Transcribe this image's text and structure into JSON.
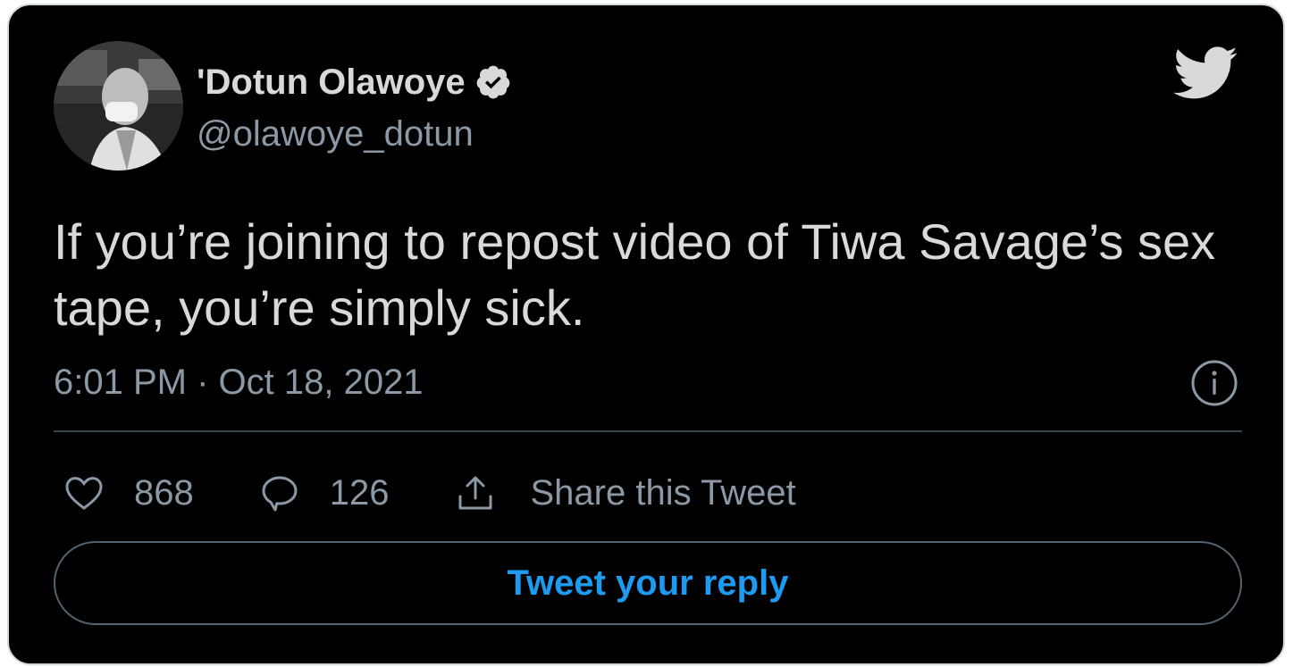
{
  "tweet": {
    "author_name": "'Dotun Olawoye",
    "handle": "@olawoye_dotun",
    "text": "If you’re joining to repost video of Tiwa Savage’s sex tape, you’re simply sick.",
    "timestamp": "6:01 PM · Oct 18, 2021"
  },
  "actions": {
    "likes": "868",
    "replies": "126",
    "share_label": "Share this Tweet"
  },
  "reply_button_label": "Tweet your reply",
  "icons": {
    "avatar": "avatar-photo",
    "verified": "verified-badge-icon",
    "brand": "twitter-bird-icon",
    "info": "info-icon",
    "like": "heart-icon",
    "reply": "comment-icon",
    "share": "share-icon"
  },
  "colors": {
    "background": "#000000",
    "text": "#d9d9d9",
    "secondary": "#8b98a5",
    "accent": "#1d9bf0",
    "border": "#cfd9de"
  }
}
